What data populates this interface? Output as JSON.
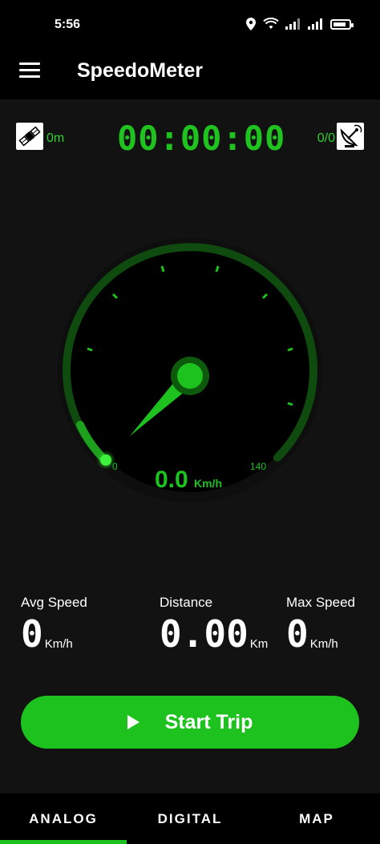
{
  "status_bar": {
    "time": "5:56",
    "icons": [
      "location-icon",
      "wifi-icon",
      "signal-icon",
      "signal-icon",
      "battery-icon"
    ]
  },
  "app_bar": {
    "title": "SpeedoMeter"
  },
  "info_row": {
    "altitude_value": "0m",
    "timer": "00:00:00",
    "satellites_value": "0/0"
  },
  "gauge": {
    "min_label": "0",
    "max_label": "140",
    "speed_value": "0.0",
    "speed_unit": "Km/h",
    "accent": "#1ec21e"
  },
  "stats": {
    "avg": {
      "label": "Avg Speed",
      "value": "0",
      "unit": "Km/h"
    },
    "distance": {
      "label": "Distance",
      "value": "0.00",
      "unit": "Km"
    },
    "max": {
      "label": "Max Speed",
      "value": "0",
      "unit": "Km/h"
    }
  },
  "start_button": {
    "label": "Start Trip"
  },
  "tabs": [
    {
      "label": "ANALOG",
      "active": true
    },
    {
      "label": "DIGITAL",
      "active": false
    },
    {
      "label": "MAP",
      "active": false
    }
  ],
  "colors": {
    "accent": "#1ec21e",
    "background": "#121212",
    "bar": "#000000"
  }
}
